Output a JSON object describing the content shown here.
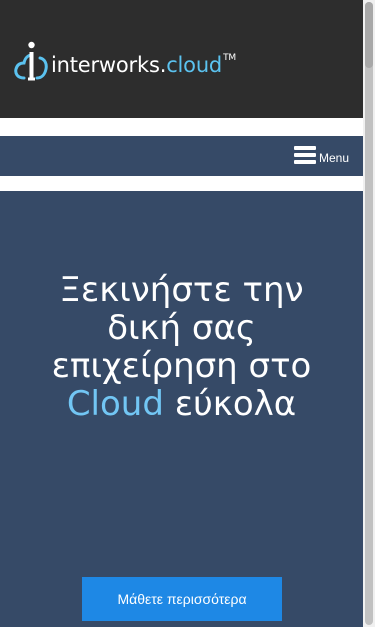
{
  "header": {
    "logo": {
      "word": "interworks",
      "dot": ".",
      "cloud": "cloud",
      "tm": "TM"
    }
  },
  "nav": {
    "menu_label": "Menu"
  },
  "hero": {
    "title_line1": "Ξεκινήστε την",
    "title_line2": "δική σας",
    "title_line3": "επιχείρηση στο",
    "title_accent": "Cloud",
    "title_tail": " εύκολα",
    "cta_label": "Μάθετε περισσότερα"
  },
  "colors": {
    "header_bg": "#2d2d2d",
    "nav_bg": "#364a67",
    "accent": "#72c6f4",
    "cta_bg": "#1e88e5"
  }
}
